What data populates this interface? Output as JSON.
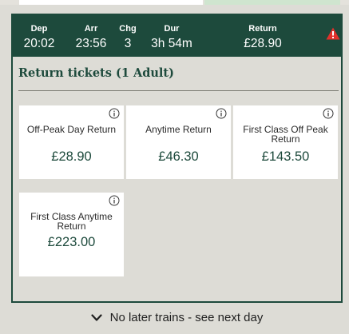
{
  "journey": {
    "departure": {
      "label": "Dep",
      "value": "20:02"
    },
    "arrival": {
      "label": "Arr",
      "value": "23:56"
    },
    "changes": {
      "label": "Chg",
      "value": "3"
    },
    "duration": {
      "label": "Dur",
      "value": "3h 54m"
    },
    "return_fare": {
      "label": "Return",
      "value": "£28.90"
    },
    "warning_icon": "warning-triangle-icon"
  },
  "section": {
    "title": "Return tickets (1 Adult)"
  },
  "tickets": [
    {
      "name": "Off-Peak Day Return",
      "price": "£28.90"
    },
    {
      "name": "Anytime Return",
      "price": "£46.30"
    },
    {
      "name": "First Class Off Peak Return",
      "price": "£143.50"
    },
    {
      "name": "First Class Anytime Return",
      "price": "£223.00"
    }
  ],
  "footer": {
    "label": "No later trains - see next day",
    "icon": "chevron-down-icon"
  },
  "colors": {
    "brand_green": "#1d4a3c",
    "warning_red": "#e0312b",
    "panel_bg": "#dddcd6"
  }
}
